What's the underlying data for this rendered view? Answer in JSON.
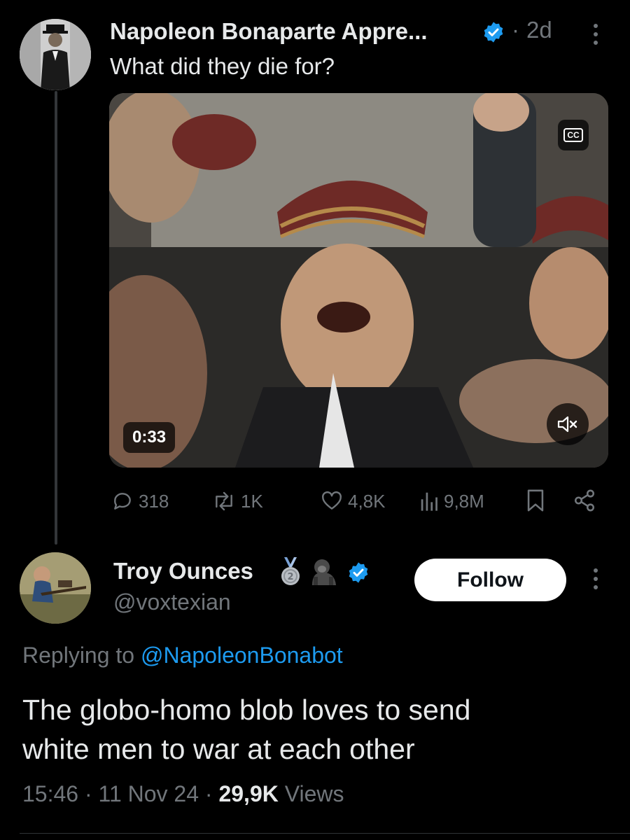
{
  "top_tweet": {
    "author_name": "Napoleon Bonaparte Appre...",
    "time_separator": "·",
    "time": "2d",
    "text": "What did they die for?",
    "video_duration": "0:33",
    "cc_label": "CC",
    "stats": {
      "replies": "318",
      "reposts": "1K",
      "likes": "4,8K",
      "views": "9,8M"
    }
  },
  "reply_tweet": {
    "author_name": "Troy Ounces",
    "handle": "@voxtexian",
    "follow_label": "Follow",
    "replying_prefix": "Replying to ",
    "replying_handle": "@NapoleonBonabot",
    "text_line1": "The globo-homo blob loves to send",
    "text_line2": "white men to war at each other",
    "time": "15:46",
    "sep1": "·",
    "date": "11 Nov 24",
    "sep2": "·",
    "views_count": "29,9K",
    "views_label": "Views",
    "emoji_badges": [
      "second-place-medal",
      "gorilla"
    ]
  },
  "colors": {
    "background": "#000000",
    "text": "#e7e9ea",
    "muted": "#71767b",
    "accent": "#1d9bf0",
    "follow_bg": "#ffffff"
  }
}
